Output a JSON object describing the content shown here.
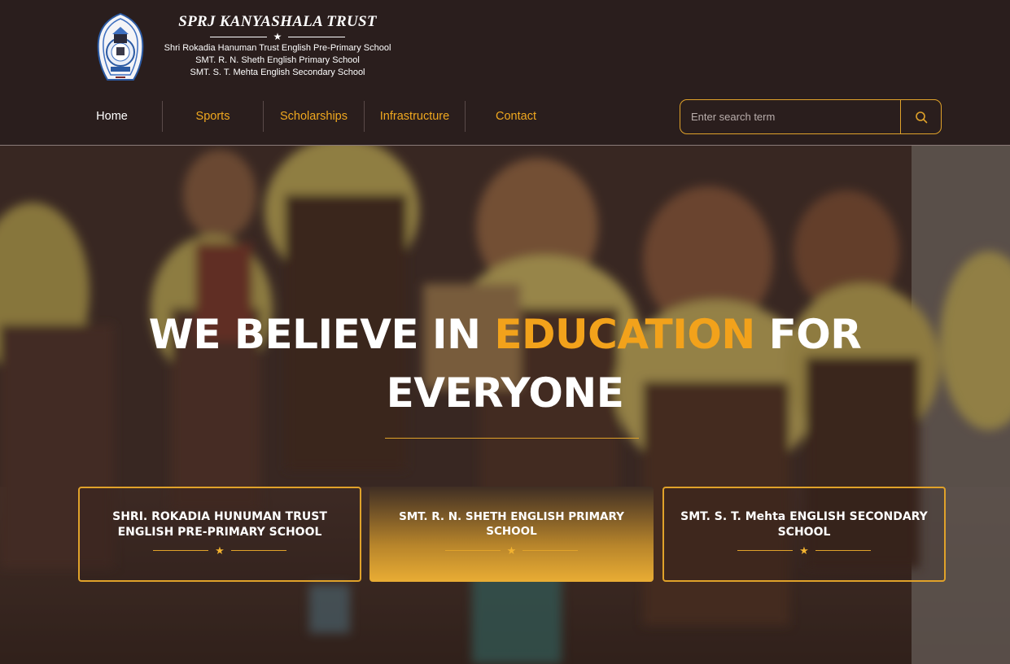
{
  "brand": {
    "title": "SPRJ KANYASHALA TRUST",
    "star": "★",
    "schools": [
      "Shri Rokadia Hanuman Trust English Pre-Primary School",
      "SMT. R. N. Sheth English Primary School",
      "SMT. S. T. Mehta English Secondary School"
    ]
  },
  "nav": {
    "items": [
      {
        "label": "Home",
        "active": true
      },
      {
        "label": "Sports"
      },
      {
        "label": "Scholarships"
      },
      {
        "label": "Infrastructure"
      },
      {
        "label": "Contact"
      }
    ]
  },
  "search": {
    "placeholder": "Enter search term",
    "icon": "search-icon"
  },
  "hero": {
    "title_part1": "WE BELIEVE IN ",
    "title_highlight": "EDUCATION",
    "title_part2": " FOR",
    "title_line2": "EVERYONE"
  },
  "cards": [
    {
      "title": "SHRI. ROKADIA HUNUMAN TRUST ENGLISH PRE-PRIMARY SCHOOL",
      "star": "★"
    },
    {
      "title": "SMT. R. N. SHETH ENGLISH PRIMARY SCHOOL",
      "star": "★"
    },
    {
      "title": "SMT. S. T. Mehta ENGLISH SECONDARY SCHOOL",
      "star": "★"
    }
  ],
  "colors": {
    "header_bg": "#2a1e1d",
    "accent": "#f2a21b",
    "border_gold": "#e0a22a"
  }
}
